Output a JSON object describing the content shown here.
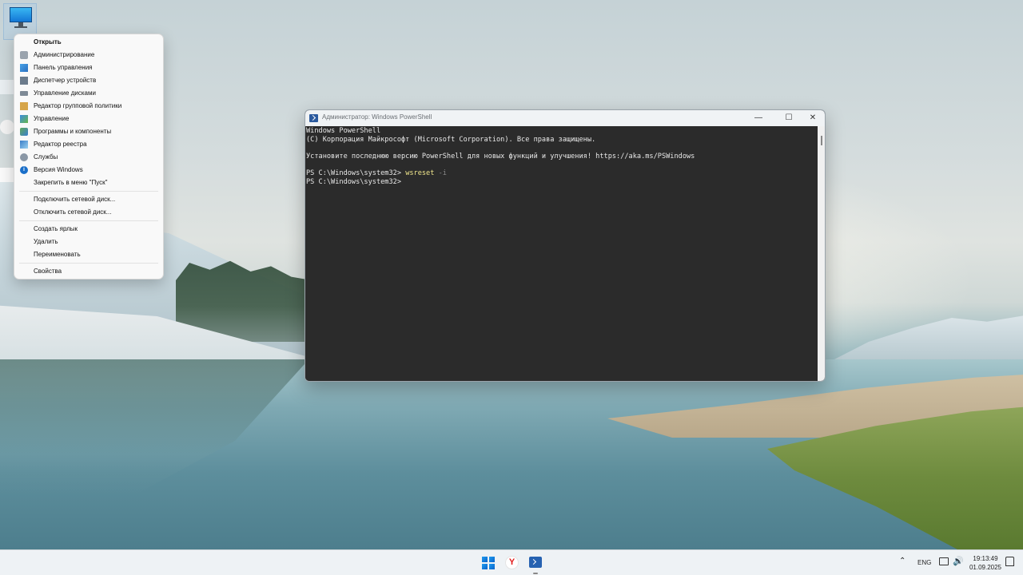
{
  "context_menu": {
    "items": [
      {
        "label": "Открыть",
        "icon": "none"
      },
      {
        "label": "Администрирование",
        "icon": "admin-tools-icon"
      },
      {
        "label": "Панель управления",
        "icon": "control-panel-icon"
      },
      {
        "label": "Диспетчер устройств",
        "icon": "device-manager-icon"
      },
      {
        "label": "Управление дисками",
        "icon": "disk-management-icon"
      },
      {
        "label": "Редактор групповой политики",
        "icon": "group-policy-icon"
      },
      {
        "label": "Управление",
        "icon": "computer-management-icon"
      },
      {
        "label": "Программы и компоненты",
        "icon": "programs-features-icon"
      },
      {
        "label": "Редактор реестра",
        "icon": "registry-editor-icon"
      },
      {
        "label": "Службы",
        "icon": "services-icon"
      },
      {
        "label": "Версия Windows",
        "icon": "info-icon"
      },
      {
        "label": "Закрепить в меню \"Пуск\"",
        "icon": "none"
      },
      {
        "label": "Подключить сетевой диск...",
        "icon": "none"
      },
      {
        "label": "Отключить сетевой диск...",
        "icon": "none"
      },
      {
        "label": "Создать ярлык",
        "icon": "none"
      },
      {
        "label": "Удалить",
        "icon": "none"
      },
      {
        "label": "Переименовать",
        "icon": "none"
      },
      {
        "label": "Свойства",
        "icon": "none"
      }
    ]
  },
  "powershell": {
    "title": "Администратор: Windows PowerShell",
    "lines": [
      "Windows PowerShell",
      "(C) Корпорация Майкрософт (Microsoft Corporation). Все права защищены.",
      "",
      "Установите последнюю версию PowerShell для новых функций и улучшения! https://aka.ms/PSWindows",
      ""
    ],
    "prompt1": {
      "prompt": "PS C:\\Windows\\system32> ",
      "command": "wsreset",
      "arg": " -i"
    },
    "prompt2": "PS C:\\Windows\\system32>",
    "controls": {
      "minimize": "—",
      "maximize": "☐",
      "close": "✕"
    }
  },
  "taskbar": {
    "tray_chevron": "⌃",
    "language": "ENG",
    "volume_glyph": "🔊",
    "time": "19:13:49",
    "date": "01.09.2025",
    "yandex_letter": "Y"
  },
  "colors": {
    "console_bg": "#2b2b2b",
    "command_color": "#f0e68c",
    "arg_color": "#8a8a8a",
    "accent": "#0a63c9"
  }
}
